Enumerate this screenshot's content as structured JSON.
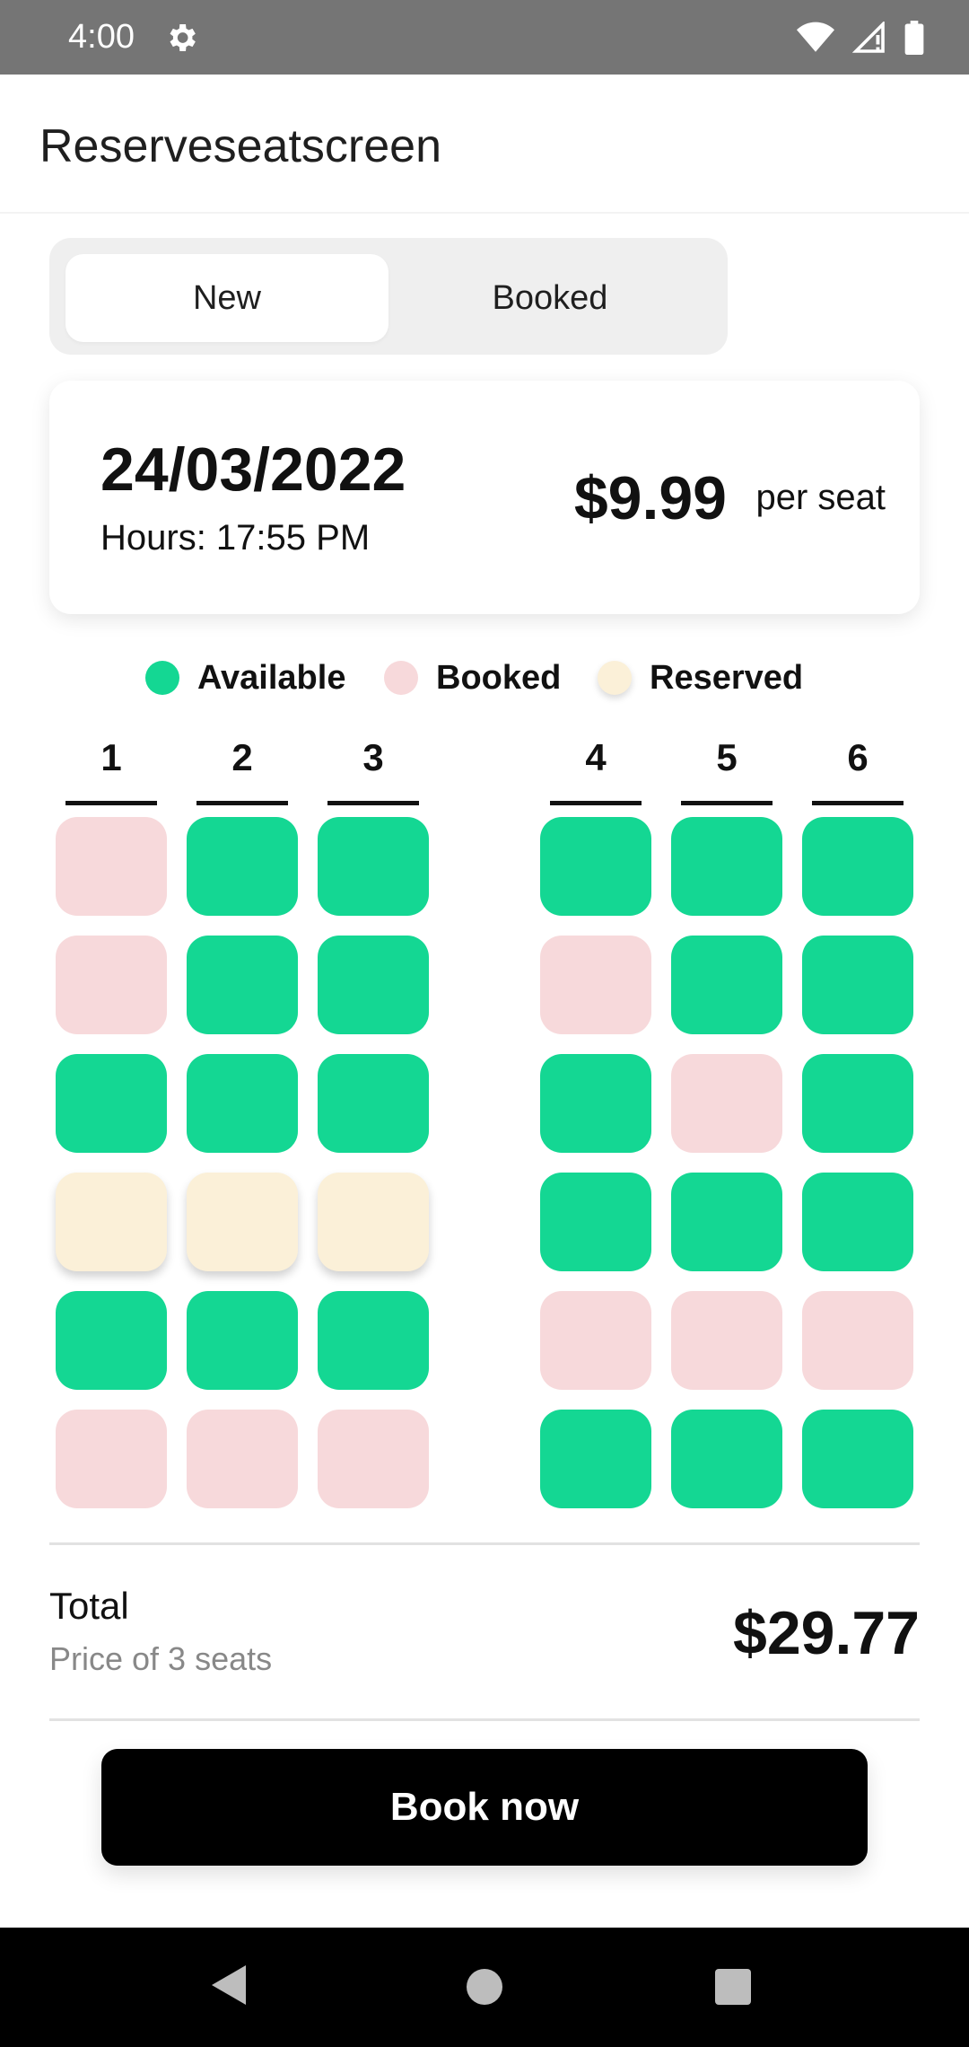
{
  "status_bar": {
    "time": "4:00"
  },
  "app_bar": {
    "title": "Reserveseatscreen"
  },
  "tabs": [
    {
      "label": "New",
      "active": true
    },
    {
      "label": "Booked",
      "active": false
    }
  ],
  "card": {
    "date": "24/03/2022",
    "hours": "Hours: 17:55 PM",
    "price": "$9.99",
    "price_unit": "per seat"
  },
  "legend": [
    {
      "label": "Available",
      "color": "#14d793"
    },
    {
      "label": "Booked",
      "color": "#f7d9db"
    },
    {
      "label": "Reserved",
      "color": "#fbf0d8"
    }
  ],
  "columns": [
    "1",
    "2",
    "3",
    "4",
    "5",
    "6"
  ],
  "seat_rows": [
    [
      "booked",
      "available",
      "available",
      "available",
      "available",
      "available"
    ],
    [
      "booked",
      "available",
      "available",
      "booked",
      "available",
      "available"
    ],
    [
      "available",
      "available",
      "available",
      "available",
      "booked",
      "available"
    ],
    [
      "reserved",
      "reserved",
      "reserved",
      "available",
      "available",
      "available"
    ],
    [
      "available",
      "available",
      "available",
      "booked",
      "booked",
      "booked"
    ],
    [
      "booked",
      "booked",
      "booked",
      "available",
      "available",
      "available"
    ]
  ],
  "total": {
    "label": "Total",
    "subtitle": "Price of 3 seats",
    "amount": "$29.77"
  },
  "book_button": {
    "label": "Book now"
  },
  "colors": {
    "available": "#14d793",
    "booked": "#f7d9db",
    "reserved": "#fbf0d8",
    "primary_button": "#000000"
  },
  "icons": {
    "status_left": "gear-icon",
    "status_right": [
      "wifi-icon",
      "signal-icon",
      "battery-icon"
    ],
    "nav": [
      "back-icon",
      "home-icon",
      "recents-icon"
    ]
  }
}
